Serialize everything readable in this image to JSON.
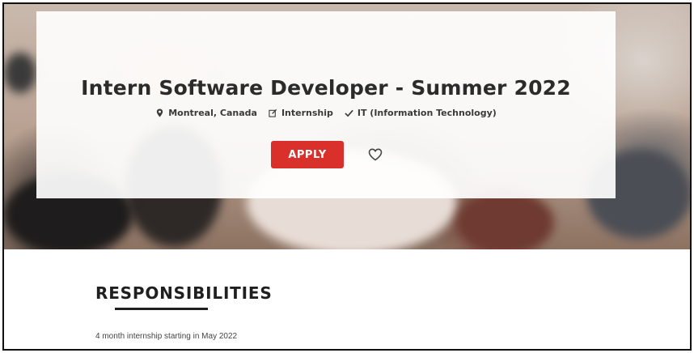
{
  "job": {
    "title": "Intern Software Developer - Summer 2022",
    "location": "Montreal, Canada",
    "type": "Internship",
    "category": "IT (Information Technology)",
    "apply_label": "APPLY"
  },
  "icons": {
    "location": "map-pin-icon",
    "type": "edit-icon",
    "category": "checkmark-icon",
    "favorite": "heart-icon"
  },
  "colors": {
    "accent": "#d9302c"
  },
  "responsibilities": {
    "heading": "RESPONSIBILITIES",
    "first_item": "4 month internship starting in May 2022"
  }
}
